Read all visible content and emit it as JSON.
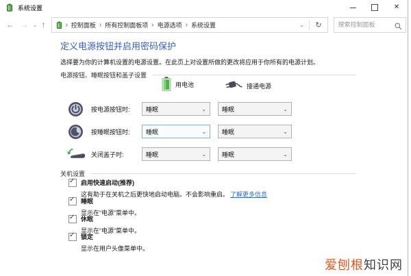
{
  "window": {
    "title": "系统设置"
  },
  "icons": {
    "back": "←",
    "forward": "→",
    "nav_dropdown": "⌄",
    "up": "↑",
    "address_chevron": "⌄",
    "refresh": "↻",
    "close": "✕",
    "combo_chevron": "⌄",
    "check": "✓",
    "breadcrumb_separator": "›"
  },
  "nav": {
    "breadcrumb": [
      "控制面板",
      "所有控制面板项",
      "电源选项",
      "系统设置"
    ],
    "search_placeholder": "搜索控制面板"
  },
  "page": {
    "heading": "定义电源按钮并启用密码保护",
    "description": "选择要为你的计算机设置的电源设置。在此页上对设置所做的更改将应用于你所有的电源计划。",
    "sections": {
      "buttons_and_lid": "电源按钮、睡眠按钮和盖子设置",
      "shutdown": "关机设置"
    },
    "columns": {
      "battery": "用电池",
      "plugged": "接通电源"
    },
    "rows": [
      {
        "label": "按电源按钮时:",
        "battery": "睡眠",
        "plugged": "睡眠"
      },
      {
        "label": "按睡眠按钮时:",
        "battery": "睡眠",
        "plugged": "睡眠"
      },
      {
        "label": "关闭盖子时:",
        "battery": "睡眠",
        "plugged": "睡眠"
      }
    ],
    "checkboxes": [
      {
        "checked": true,
        "label": "启用快速启动(推荐)",
        "desc": "这有助于在关机之后更快地启动电脑。不会影响重启。",
        "link": "了解更多信息"
      },
      {
        "checked": true,
        "label": "睡眠",
        "desc": "显示在“电源”菜单中。"
      },
      {
        "checked": true,
        "label": "休眠",
        "desc": "显示在“电源”菜单中。"
      },
      {
        "checked": true,
        "label": "锁定",
        "desc": "显示在用户头像菜单中。"
      }
    ]
  },
  "watermark": {
    "highlight": "爱刨根",
    "rest": "知识网"
  },
  "colors": {
    "heading": "#3a5fc4",
    "link": "#2e70c8",
    "battery_green": "#44b63c",
    "icon_slate": "#515169",
    "watermark_highlight": "#e8561e"
  }
}
